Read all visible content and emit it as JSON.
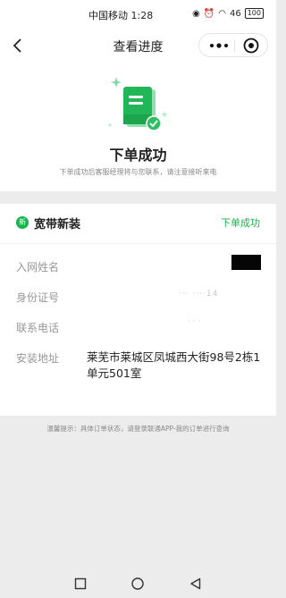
{
  "status_bar": {
    "carrier_time": "中国移动 1:28",
    "signal": "46",
    "battery": "100"
  },
  "nav": {
    "title": "查看进度"
  },
  "result": {
    "title": "下单成功",
    "subtitle": "下单成功后客服经理将与您联系，请注意接听来电"
  },
  "order": {
    "badge": "新",
    "product": "宽带新装",
    "status": "下单成功",
    "fields": [
      {
        "label": "入网姓名",
        "value": ""
      },
      {
        "label": "身份证号",
        "value": "··· ····14"
      },
      {
        "label": "联系电话",
        "value": "· · ·"
      },
      {
        "label": "安装地址",
        "value": "莱芜市莱城区凤城西大街98号2栋1单元501室"
      }
    ]
  },
  "tip": "温馨提示：具体订单状态，请登录联通APP-我的订单进行查询",
  "colors": {
    "accent": "#18b34a",
    "background": "#ececec"
  }
}
